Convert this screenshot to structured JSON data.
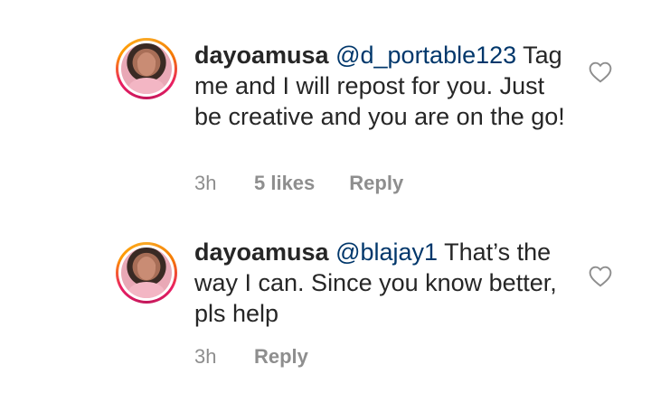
{
  "comments": [
    {
      "username": "dayoamusa",
      "mention": "@d_portable123",
      "text": " Tag me and I will repost for you. Just be creative and you are on the go!",
      "time": "3h",
      "likes": "5 likes",
      "reply_label": "Reply",
      "like_icon": "heart-outline-icon"
    },
    {
      "username": "dayoamusa",
      "mention": "@blajay1",
      "text": " That’s the way I can. Since you know better, pls help",
      "time": "3h",
      "reply_label": "Reply",
      "like_icon": "heart-outline-icon"
    }
  ]
}
